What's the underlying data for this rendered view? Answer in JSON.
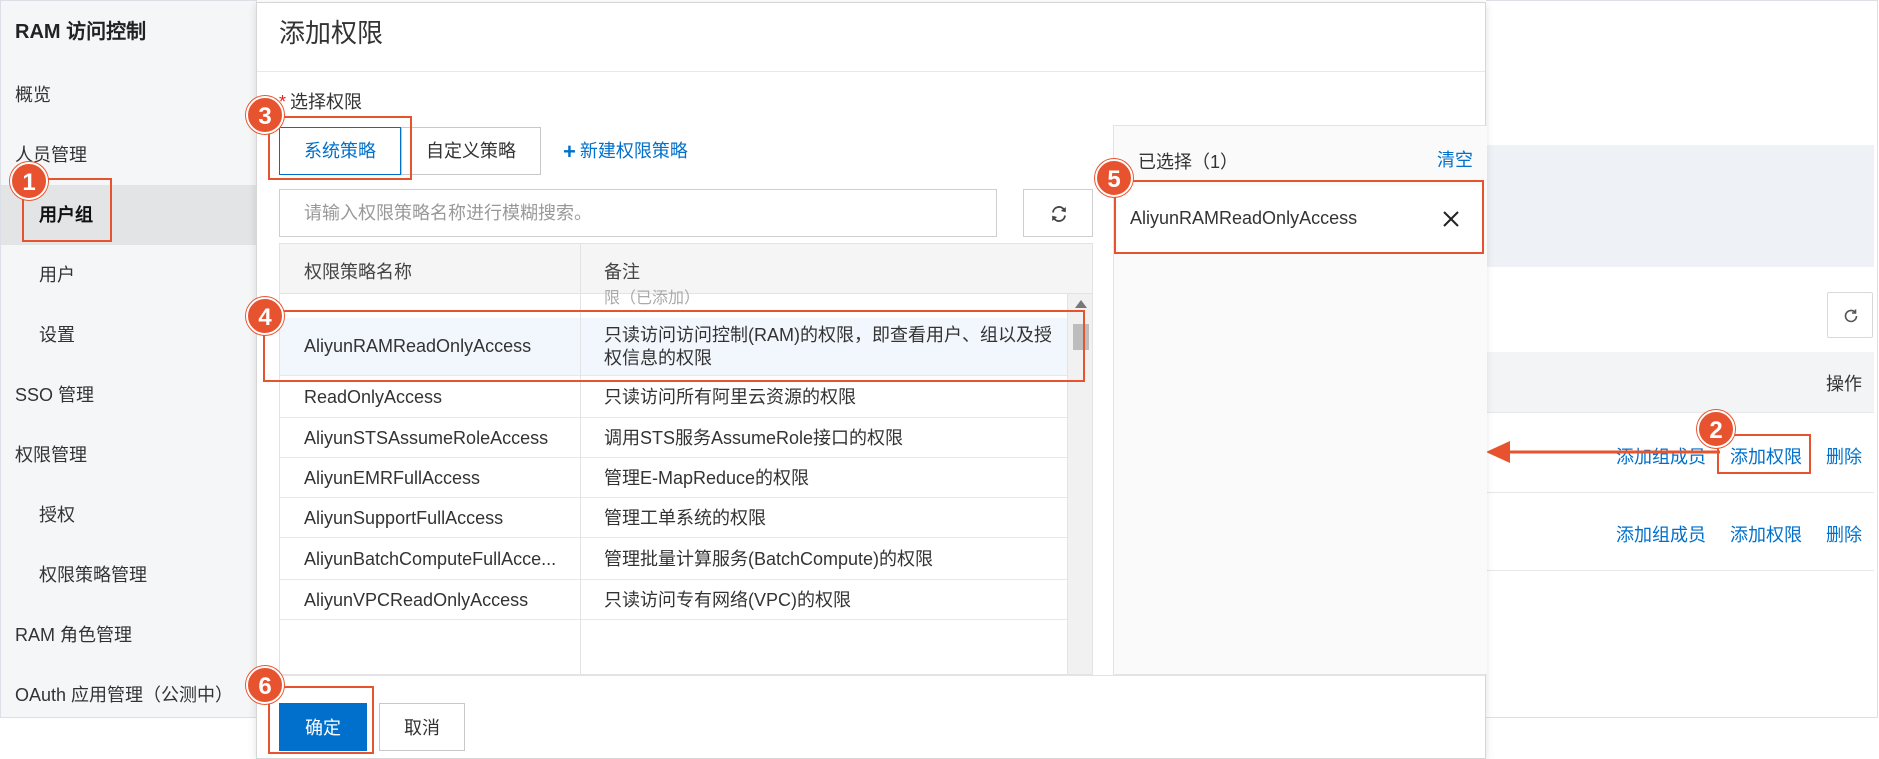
{
  "sidebar": {
    "title": "RAM 访问控制",
    "items": [
      {
        "label": "概览"
      },
      {
        "label": "人员管理"
      },
      {
        "label": "用户组"
      },
      {
        "label": "用户"
      },
      {
        "label": "设置"
      },
      {
        "label": "SSO 管理"
      },
      {
        "label": "权限管理"
      },
      {
        "label": "授权"
      },
      {
        "label": "权限策略管理"
      },
      {
        "label": "RAM 角色管理"
      },
      {
        "label": "OAuth 应用管理（公测中）"
      }
    ]
  },
  "modal": {
    "title": "添加权限",
    "select_label": "选择权限",
    "tabs": [
      {
        "label": "系统策略",
        "active": true
      },
      {
        "label": "自定义策略",
        "active": false
      }
    ],
    "new_policy_label": "新建权限策略",
    "search": {
      "placeholder": "请输入权限策略名称进行模糊搜索。",
      "value": ""
    },
    "table": {
      "headers": [
        "权限策略名称",
        "备注"
      ],
      "partial_above": "限（已添加）",
      "rows": [
        {
          "name": "AliyunRAMReadOnlyAccess",
          "note": "只读访问访问控制(RAM)的权限，即查看用户、组以及授权信息的权限",
          "selected": true
        },
        {
          "name": "ReadOnlyAccess",
          "note": "只读访问所有阿里云资源的权限"
        },
        {
          "name": "AliyunSTSAssumeRoleAccess",
          "note": "调用STS服务AssumeRole接口的权限"
        },
        {
          "name": "AliyunEMRFullAccess",
          "note": "管理E-MapReduce的权限"
        },
        {
          "name": "AliyunSupportFullAccess",
          "note": "管理工单系统的权限"
        },
        {
          "name": "AliyunBatchComputeFullAcce...",
          "note": "管理批量计算服务(BatchCompute)的权限"
        },
        {
          "name": "AliyunVPCReadOnlyAccess",
          "note": "只读访问专有网络(VPC)的权限"
        }
      ]
    },
    "selected_panel": {
      "title": "已选择（1）",
      "clear_label": "清空",
      "items": [
        {
          "name": "AliyunRAMReadOnlyAccess"
        }
      ]
    },
    "ok_label": "确定",
    "cancel_label": "取消"
  },
  "background": {
    "operation_header": "操作",
    "rows": [
      {
        "add_member": "添加组成员",
        "add_permission": "添加权限",
        "delete": "删除"
      },
      {
        "add_member": "添加组成员",
        "add_permission": "添加权限",
        "delete": "删除"
      }
    ]
  },
  "annotations": {
    "color": "#e8532f",
    "badges": [
      "1",
      "2",
      "3",
      "4",
      "5",
      "6"
    ]
  },
  "colors": {
    "accent": "#0070cc",
    "highlight": "#e8532f"
  }
}
